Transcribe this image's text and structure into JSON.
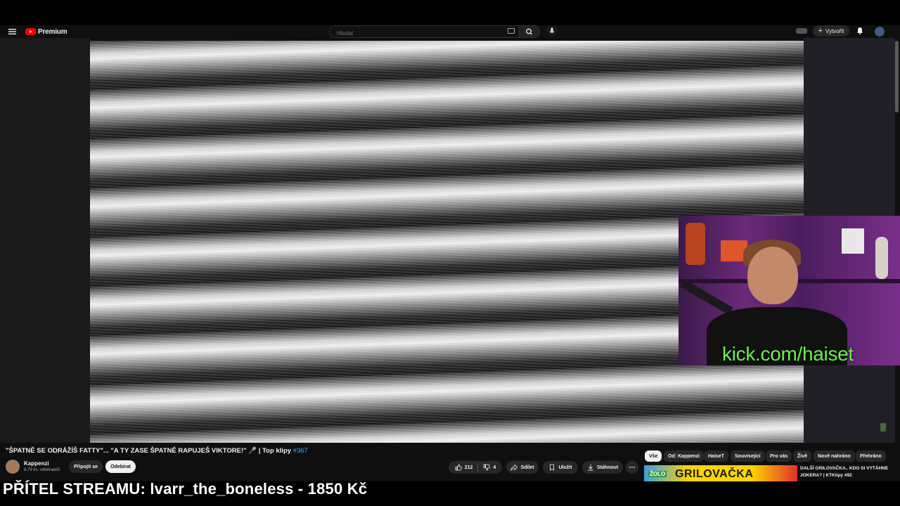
{
  "header": {
    "logo_text": "Premium",
    "search_placeholder": "Hledat",
    "create_label": "Vytvořit",
    "icons": [
      "menu-icon",
      "youtube-logo-icon",
      "keyboard-icon",
      "search-icon",
      "mic-icon",
      "cast-icon",
      "plus-icon",
      "bell-icon",
      "account-avatar"
    ]
  },
  "player": {
    "webcam_overlay_text": "kick.com/haiset"
  },
  "video": {
    "title": "\"ŠPATNĚ SE ODRÁŽÍŠ FATTY\"... \"A TY ZASE ŠPATNĚ RAPUJEŠ VIKTORE!\" 🎤 | Top klipy ",
    "episode_tag": "#367",
    "channel_name": "Kappenzi",
    "subscribers": "8,79 tis. odběratelů",
    "join_label": "Připojit se",
    "subscribe_label": "Odebírat",
    "likes": "212",
    "dislikes": "4",
    "share_label": "Sdílet",
    "save_label": "Uložit",
    "download_label": "Stáhnout"
  },
  "chips": [
    "Vše",
    "Od: Kappenzi",
    "HaiseT",
    "Související",
    "Pro vás",
    "Živě",
    "Nově nahráno",
    "Přehráno"
  ],
  "recommendation": {
    "thumb_badge": "ŽOLO",
    "thumb_text": "GRILOVAČKA",
    "title": "DALŠÍ GRILOVAČKA.. KDO SI VYTÁHNE JOKERA? | KTKlipy #92"
  },
  "stream_overlay": {
    "text": "PŘÍTEL STREAMU: lvarr_the_boneless - 1850 Kč"
  },
  "colors": {
    "background": "#0f0f0f",
    "brand_red": "#ff0000",
    "link_blue": "#3ea6ff",
    "kick_green": "#69f24e"
  }
}
